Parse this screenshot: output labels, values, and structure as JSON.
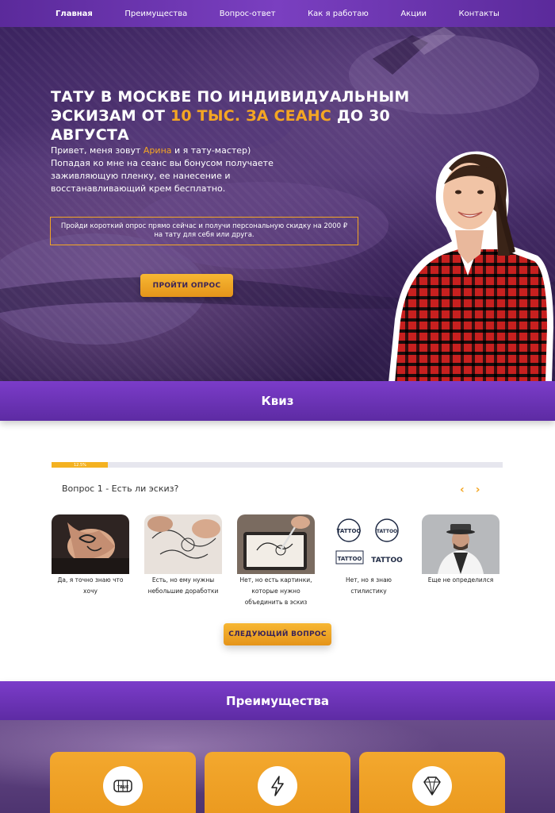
{
  "nav": {
    "items": [
      {
        "label": "Главная",
        "active": true
      },
      {
        "label": "Преимущества"
      },
      {
        "label": "Вопрос-ответ"
      },
      {
        "label": "Как я работаю"
      },
      {
        "label": "Акции"
      },
      {
        "label": "Контакты"
      }
    ]
  },
  "hero": {
    "title_line1": "ТАТУ В МОСКВЕ ПО ИНДИВИДУАЛЬНЫМ",
    "title_line2_prefix": "ЭСКИЗАМ ОТ",
    "title_line2_accent": "10 ТЫС. ЗА СЕАНС",
    "title_line2_suffix": "ДО 30 АВГУСТА",
    "intro_prefix": "Привет, меня зовут",
    "intro_name": "Арина",
    "intro_suffix": "и я тату-мастер)",
    "intro_body": "Попадая ко мне на сеанс вы бонусом получаете заживляющую пленку, ее нанесение и восстанавливающий крем бесплатно.",
    "promo": "Пройди короткий опрос прямо сейчас и получи персональную скидку на 2000 ₽ на тату для себя или друга.",
    "button": "ПРОЙТИ ОПРОС"
  },
  "quiz": {
    "section_title": "Квиз",
    "progress_label": "12.5%",
    "progress_fraction": 0.125,
    "question": "Вопрос 1 - Есть ли эскиз?",
    "prev_arrow": "‹",
    "next_arrow": "›",
    "options": [
      {
        "label": "Да, я точно знаю что хочу"
      },
      {
        "label": "Есть, но ему нужны небольшие доработки"
      },
      {
        "label": "Нет, но есть картинки, которые нужно объединить в эскиз"
      },
      {
        "label": "Нет, но я знаю стилистику"
      },
      {
        "label": "Еще не определился"
      }
    ],
    "tattoo_words": [
      "TATTOO",
      "TATTOO",
      "TATTOO",
      "TATTOO"
    ],
    "next_button": "СЛЕДУЮЩИЙ ВОПРОС"
  },
  "advantages": {
    "section_title": "Преимущества",
    "knuckle_text": "TRUE",
    "cards": [
      {
        "icon": "fist-icon"
      },
      {
        "icon": "lightning-icon"
      },
      {
        "icon": "diamond-icon"
      }
    ]
  },
  "colors": {
    "accent": "#f4a623",
    "purple": "#6a33b5",
    "hero_bg": "#3c2460"
  }
}
